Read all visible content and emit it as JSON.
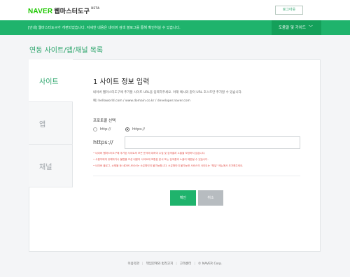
{
  "header": {
    "logo_naver": "NAVER",
    "logo_title": "웹마스터도구",
    "logo_beta": "BETA",
    "login_label": "로그아웃"
  },
  "notice": {
    "text": "[안내] 웹마스터도구가 개편되었습니다. 자세한 내용은 네이버 검색 블로그를 통해 확인하실 수 있습니다.",
    "help_label": "도움말 및 가이드",
    "help_icon": "chevron-down-icon"
  },
  "page": {
    "title": "연동 사이트/앱/채널 목록"
  },
  "tabs": [
    {
      "label": "사이트",
      "active": true
    },
    {
      "label": "앱",
      "active": false
    },
    {
      "label": "채널",
      "active": false
    }
  ],
  "form": {
    "title": "1 사이트 정보 입력",
    "description": "네이버 웹마스터도구에 추가할 사이트 URL을 입력하주세요. 아래 예시와 같이 URL 호스트만 추가할 수 있습니다.",
    "example": "예) helloworld.com / www.domain.co.kr / developer.naver.com",
    "protocol_label": "프로토콜 선택",
    "protocol_options": [
      "http://",
      "https://"
    ],
    "protocol_selected": "https://",
    "url_prefix": "https://",
    "url_value": "",
    "warnings": [
      "• 네이버 웹마스터도구에 추가된 사이트의 모든 문서에 대하여 수집 및 검색결과 노출을 보장하지 않습니다.",
      "• 사용자에게 유해하거나 불법을 조성 내용의 사이트에 포함된 문서 또는 검색결과 노출이 제한될 수 있습니다.",
      "• 네이버 블로그, 쇼핑몰 등 네이버 서비스는 소유확인이 불가능합니다. 소유확인이 불가능한 서비스의 사이트는 \"채널\" 메뉴에서 추가해주세요."
    ],
    "confirm_label": "확인",
    "cancel_label": "취소"
  },
  "footer": {
    "links": [
      "이용약관",
      "책임한계와 법적고지",
      "고객센터"
    ],
    "copyright": "© NAVER Corp."
  },
  "colors": {
    "brand_green": "#1fb36c",
    "naver_green": "#1ec800",
    "warning_red": "#e2514a"
  }
}
